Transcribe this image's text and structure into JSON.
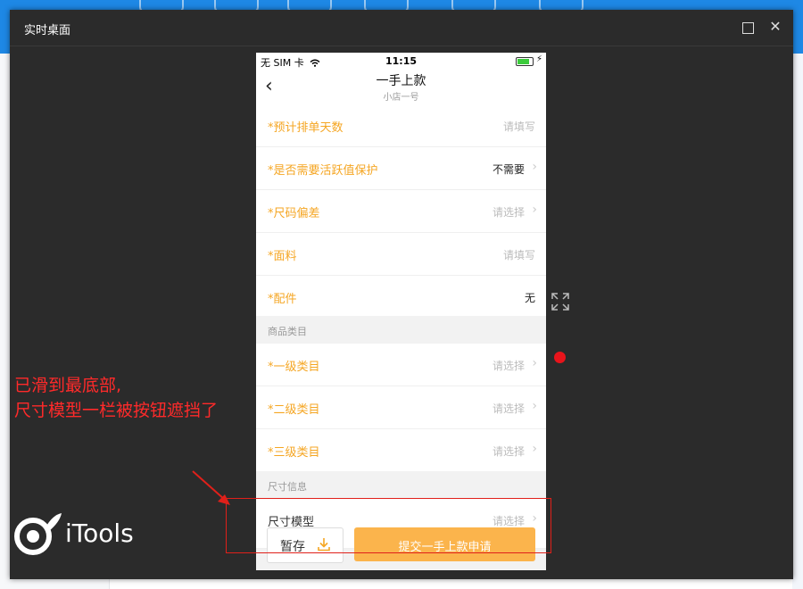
{
  "modal": {
    "title": "实时桌面"
  },
  "phone": {
    "status": {
      "carrier": "无 SIM 卡",
      "time": "11:15",
      "battery_level": 0.8
    },
    "nav": {
      "back": "‹",
      "title": "一手上款",
      "subtitle": "小店一号"
    },
    "rows_1": [
      {
        "label": "*预计排单天数",
        "value": "请填写",
        "chevron": false,
        "value_style": "placeholder"
      },
      {
        "label": "*是否需要活跃值保护",
        "value": "不需要",
        "chevron": true,
        "value_style": "filled"
      },
      {
        "label": "*尺码偏差",
        "value": "请选择",
        "chevron": true,
        "value_style": "placeholder"
      },
      {
        "label": "*面料",
        "value": "请填写",
        "chevron": false,
        "value_style": "placeholder"
      },
      {
        "label": "*配件",
        "value": "无",
        "chevron": false,
        "value_style": "filled"
      }
    ],
    "section_category": "商品类目",
    "rows_2": [
      {
        "label": "*一级类目",
        "value": "请选择",
        "chevron": true
      },
      {
        "label": "*二级类目",
        "value": "请选择",
        "chevron": true
      },
      {
        "label": "*三级类目",
        "value": "请选择",
        "chevron": true
      }
    ],
    "section_size": "尺寸信息",
    "size_model": {
      "label": "尺寸模型",
      "value": "请选择"
    },
    "buttons": {
      "save": "暂存",
      "submit": "提交一手上款申请"
    }
  },
  "annotation": {
    "line1": "已滑到最底部,",
    "line2": "尺寸模型一栏被按钮遮挡了"
  },
  "brand": {
    "name": "iTools"
  },
  "colors": {
    "accent_orange": "#f5a623",
    "submit_bg": "#fbb44c",
    "annotation_red": "#ff2a2a",
    "modal_bg": "#2b2b2b",
    "app_blue": "#1e88e5"
  }
}
